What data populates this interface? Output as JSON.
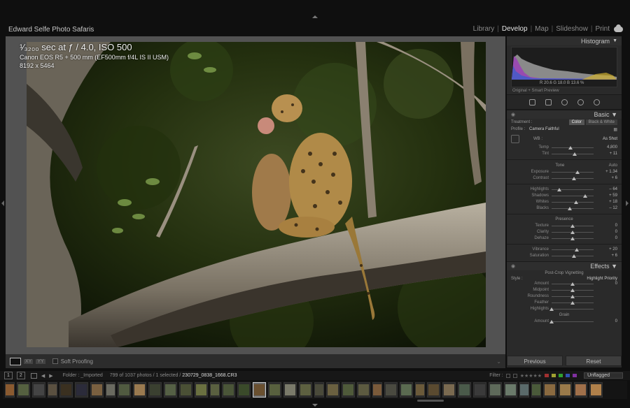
{
  "identity_plate": "Edward Selfe Photo Safaris",
  "modules": [
    {
      "label": "Library",
      "active": false
    },
    {
      "label": "Develop",
      "active": true
    },
    {
      "label": "Map",
      "active": false
    },
    {
      "label": "Slideshow",
      "active": false
    },
    {
      "label": "Print",
      "active": false
    }
  ],
  "photo_info": {
    "line1": "¹⁄₃₂₀₀ sec at ƒ / 4.0, ISO 500",
    "line2": "Canon EOS R5 + 500 mm (EF500mm f/4L IS II USM)",
    "line3": "8192 x 5464"
  },
  "toolbar": {
    "soft_proofing": "Soft Proofing"
  },
  "right_panel": {
    "histogram_title": "Histogram",
    "histogram_readout": "R  20.6   G  18.0   B  13.6  %",
    "preview_label": "Original + Smart Preview",
    "basic": {
      "title": "Basic",
      "treatment_label": "Treatment :",
      "treatment_color": "Color",
      "treatment_bw": "Black & White",
      "profile_label": "Profile :",
      "profile_value": "Camera Faithful",
      "wb_label": "WB :",
      "wb_value": "As Shot",
      "sliders_wb": [
        {
          "label": "Temp",
          "value": "4,800",
          "pos": 0.45
        },
        {
          "label": "Tint",
          "value": "+ 11",
          "pos": 0.55
        }
      ],
      "tone_label": "Tone",
      "auto_label": "Auto",
      "sliders_tone": [
        {
          "label": "Exposure",
          "value": "+ 1.34",
          "pos": 0.62
        },
        {
          "label": "Contrast",
          "value": "+ 6",
          "pos": 0.53
        }
      ],
      "sliders_tone2": [
        {
          "label": "Highlights",
          "value": "– 64",
          "pos": 0.18
        },
        {
          "label": "Shadows",
          "value": "+ 59",
          "pos": 0.8
        },
        {
          "label": "Whites",
          "value": "+ 18",
          "pos": 0.59
        },
        {
          "label": "Blacks",
          "value": "– 12",
          "pos": 0.44
        }
      ],
      "presence_label": "Presence",
      "sliders_presence": [
        {
          "label": "Texture",
          "value": "0",
          "pos": 0.5
        },
        {
          "label": "Clarity",
          "value": "0",
          "pos": 0.5
        },
        {
          "label": "Dehaze",
          "value": "0",
          "pos": 0.5
        }
      ],
      "sliders_presence2": [
        {
          "label": "Vibrance",
          "value": "+ 20",
          "pos": 0.6
        },
        {
          "label": "Saturation",
          "value": "+ 6",
          "pos": 0.53
        }
      ]
    },
    "effects": {
      "title": "Effects",
      "vignette_label": "Post-Crop Vignetting",
      "style_label": "Style :",
      "style_value": "Highlight Priority",
      "sliders": [
        {
          "label": "Amount",
          "value": "0",
          "pos": 0.5
        },
        {
          "label": "Midpoint",
          "value": "",
          "pos": 0.5
        },
        {
          "label": "Roundness",
          "value": "",
          "pos": 0.5
        },
        {
          "label": "Feather",
          "value": "",
          "pos": 0.5
        },
        {
          "label": "Highlights",
          "value": "",
          "pos": 0.0
        }
      ],
      "grain_label": "Grain",
      "grain_sliders": [
        {
          "label": "Amount",
          "value": "0",
          "pos": 0.0
        }
      ]
    },
    "previous_button": "Previous",
    "reset_button": "Reset"
  },
  "filmstrip_bar": {
    "screen1": "1",
    "screen2": "2",
    "folder_label": "Folder : _Imported",
    "count_text": "799 of 1037 photos / 1 selected /",
    "filename": "230729_0838_1668.CR3",
    "filter_label": "Filter :",
    "unflagged": "Unflagged"
  },
  "filmstrip": {
    "thumb_colors": [
      "#8a5a30",
      "#556040",
      "#444",
      "#5a5040",
      "#3a3020",
      "#2b2b3a",
      "#7a6040",
      "#6a6a60",
      "#505a40",
      "#9a7a50",
      "#3a4030",
      "#556045",
      "#4a5035",
      "#6a7040",
      "#5a6040",
      "#4a5538",
      "#3a4a2a",
      "#6a5030",
      "#58603e",
      "#7a7a6a",
      "#5d6040",
      "#4a4a3a",
      "#6a6040",
      "#4f5a3a",
      "#5c5a40",
      "#7a5a3a",
      "#4a4a40",
      "#5a6a50",
      "#6b5a3a",
      "#5a4a30",
      "#7a6a50",
      "#4a5a4a",
      "#3a3a3a",
      "#5e6a5a",
      "#6a7a6a",
      "#5a6a6a",
      "#4a5a3a",
      "#8a6a40",
      "#9a7a4a",
      "#a0704a",
      "#b0804a"
    ],
    "selected_index": 17
  }
}
